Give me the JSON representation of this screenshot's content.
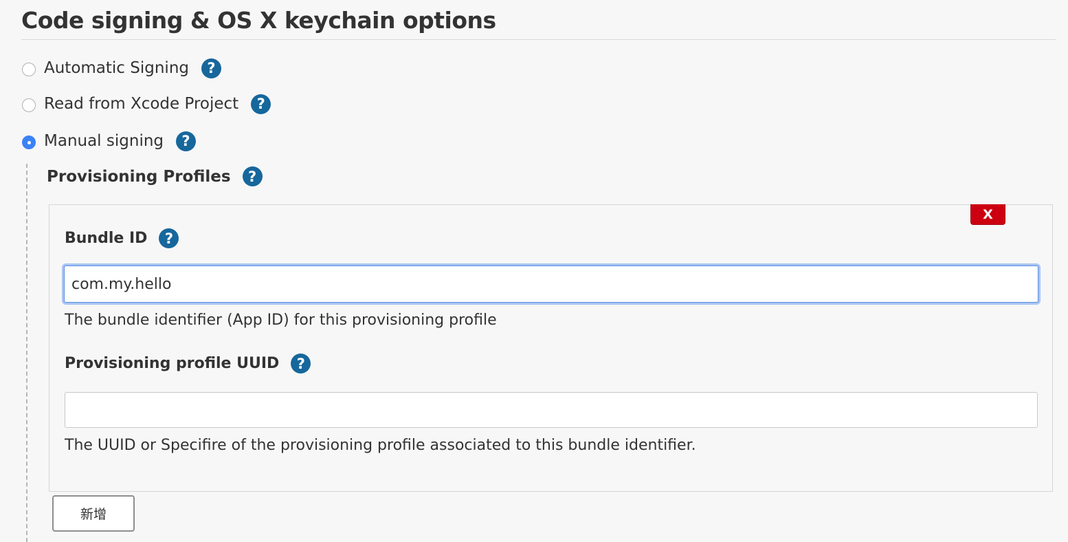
{
  "section": {
    "title": "Code signing & OS X keychain options"
  },
  "signing_options": [
    {
      "label": "Automatic Signing",
      "selected": false
    },
    {
      "label": "Read from Xcode Project",
      "selected": false
    },
    {
      "label": "Manual signing",
      "selected": true
    }
  ],
  "help_glyph": "?",
  "manual": {
    "profiles_label": "Provisioning Profiles",
    "profile_entry": {
      "delete_label": "X",
      "bundle_id": {
        "label": "Bundle ID",
        "value": "com.my.hello",
        "hint": "The bundle identifier (App ID) for this provisioning profile"
      },
      "uuid": {
        "label": "Provisioning profile UUID",
        "value": "",
        "hint": "The UUID or Specifire of the provisioning profile associated to this bundle identifier."
      }
    },
    "add_label": "新增"
  },
  "colors": {
    "help_icon": "#16679c",
    "delete_button": "#cc0011",
    "radio_selected": "#3b82f6",
    "focus_ring": "#689aee"
  },
  "icons": {
    "help": "help-icon",
    "radio": "radio-button"
  }
}
